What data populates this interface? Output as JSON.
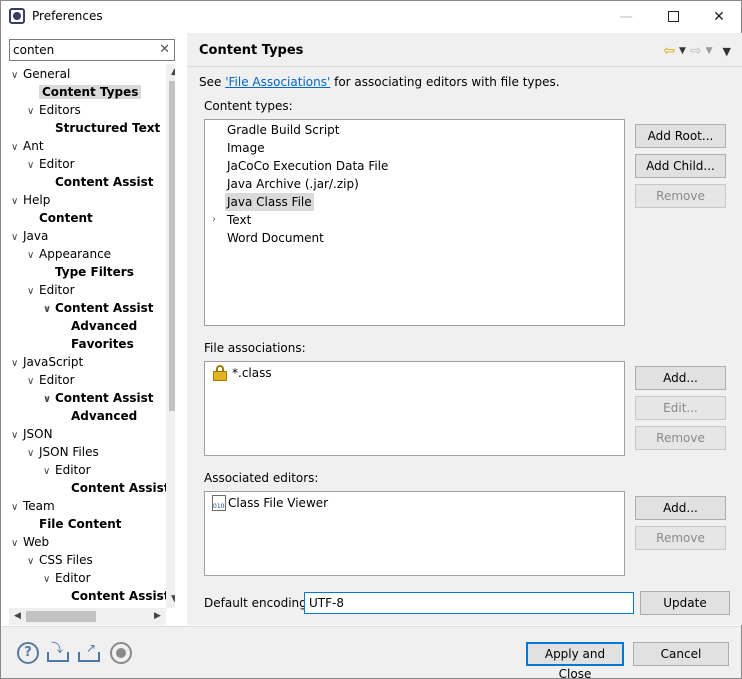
{
  "window": {
    "title": "Preferences"
  },
  "filter": {
    "value": "conten"
  },
  "tree": [
    {
      "label": "General",
      "expanded": true
    },
    {
      "label": "Content Types",
      "bold": true,
      "selected": true
    },
    {
      "label": "Editors",
      "expanded": true
    },
    {
      "label": "Structured Text",
      "bold": true
    },
    {
      "label": "Ant",
      "expanded": true
    },
    {
      "label": "Editor",
      "expanded": true
    },
    {
      "label": "Content Assist",
      "bold": true
    },
    {
      "label": "Help",
      "expanded": true
    },
    {
      "label": "Content",
      "bold": true
    },
    {
      "label": "Java",
      "expanded": true
    },
    {
      "label": "Appearance",
      "expanded": true
    },
    {
      "label": "Type Filters",
      "bold": true
    },
    {
      "label": "Editor",
      "expanded": true
    },
    {
      "label": "Content Assist",
      "bold": true,
      "expanded": true
    },
    {
      "label": "Advanced",
      "bold": true
    },
    {
      "label": "Favorites",
      "bold": true
    },
    {
      "label": "JavaScript",
      "expanded": true
    },
    {
      "label": "Editor",
      "expanded": true
    },
    {
      "label": "Content Assist",
      "bold": true,
      "expanded": true
    },
    {
      "label": "Advanced",
      "bold": true
    },
    {
      "label": "JSON",
      "expanded": true
    },
    {
      "label": "JSON Files",
      "expanded": true
    },
    {
      "label": "Editor",
      "expanded": true
    },
    {
      "label": "Content Assist",
      "bold": true
    },
    {
      "label": "Team",
      "expanded": true
    },
    {
      "label": "File Content",
      "bold": true
    },
    {
      "label": "Web",
      "expanded": true
    },
    {
      "label": "CSS Files",
      "expanded": true
    },
    {
      "label": "Editor",
      "expanded": true
    },
    {
      "label": "Content Assist",
      "bold": true
    }
  ],
  "page": {
    "title": "Content Types",
    "see_prefix": "See ",
    "see_link": "'File Associations'",
    "see_suffix": " for associating editors with file types.",
    "content_types_label": "Content types:",
    "content_types": [
      {
        "label": "Gradle Build Script"
      },
      {
        "label": "Image"
      },
      {
        "label": "JaCoCo Execution Data File"
      },
      {
        "label": "Java Archive (.jar/.zip)"
      },
      {
        "label": "Java Class File",
        "selected": true
      },
      {
        "label": "Text",
        "expandable": true
      },
      {
        "label": "Word Document"
      }
    ],
    "file_associations_label": "File associations:",
    "file_associations": [
      {
        "label": "*.class",
        "locked": true
      }
    ],
    "associated_editors_label": "Associated editors:",
    "associated_editors": [
      {
        "label": "Class File Viewer"
      }
    ],
    "default_encoding_label": "Default encoding:",
    "default_encoding_value": "UTF-8"
  },
  "buttons": {
    "add_root": "Add Root...",
    "add_child": "Add Child...",
    "remove_ct": "Remove",
    "add_assoc": "Add...",
    "edit_assoc": "Edit...",
    "remove_assoc": "Remove",
    "add_editor": "Add...",
    "remove_editor": "Remove",
    "update": "Update",
    "apply_close": "Apply and Close",
    "cancel": "Cancel"
  }
}
